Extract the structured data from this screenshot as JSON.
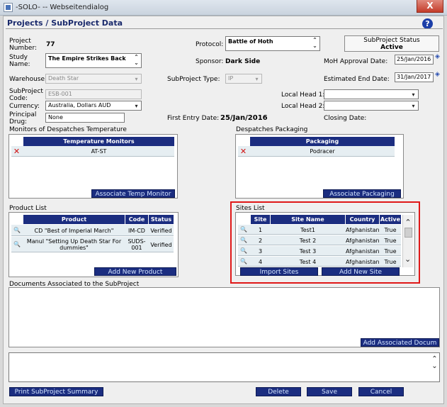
{
  "window": {
    "title": "-SOLO- -- Webseitendialog",
    "close_glyph": "X"
  },
  "header": {
    "title": "Projects / SubProject Data",
    "help_glyph": "?"
  },
  "form": {
    "project_number_label": "Project Number:",
    "project_number": "77",
    "study_name_label": "Study Name:",
    "study_name": "The Empire Strikes Back",
    "protocol_label": "Protocol:",
    "protocol": "Battle of Hoth",
    "sponsor_label": "Sponsor:",
    "sponsor": "Dark Side",
    "status_title": "SubProject Status",
    "status_value": "Active",
    "moh_label": "MoH Approval Date:",
    "moh_date": "25/Jan/2016",
    "warehouse_label": "Warehouse:",
    "warehouse": "Death Star",
    "subproject_type_label": "SubProject Type:",
    "subproject_type": "IP",
    "est_end_label": "Estimated End Date:",
    "est_end_date": "31/Jan/2017",
    "subproject_code_label": "SubProject Code:",
    "subproject_code": "ESB-001",
    "local_head1_label": "Local Head 1:",
    "local_head1": "",
    "currency_label": "Currency:",
    "currency": "Australia, Dollars AUD",
    "local_head2_label": "Local Head 2:",
    "local_head2": "",
    "principal_drug_label": "Principal Drug:",
    "principal_drug": "None",
    "first_entry_label": "First Entry Date:",
    "first_entry_date": "25/Jan/2016",
    "closing_label": "Closing Date:",
    "closing_date": ""
  },
  "monitors": {
    "title": "Monitors of Despatches Temperature",
    "column": "Temperature Monitors",
    "rows": [
      "AT-ST"
    ],
    "button": "Associate Temp Monitor"
  },
  "packaging": {
    "title": "Despatches Packaging",
    "column": "Packaging",
    "rows": [
      "Podracer"
    ],
    "button": "Associate Packaging"
  },
  "products": {
    "title": "Product List",
    "columns": [
      "Product",
      "Code",
      "Status"
    ],
    "rows": [
      {
        "product": "CD \"Best of Imperial March\"",
        "code": "IM-CD",
        "status": "Verified"
      },
      {
        "product_line1": "Manul \"Setting Up Death Star For",
        "product_line2": "dummies\"",
        "code_line1": "SUDS-",
        "code_line2": "001",
        "status": "Verified"
      }
    ],
    "button": "Add New Product"
  },
  "sites": {
    "title": "Sites List",
    "columns": [
      "Site",
      "Site Name",
      "Country",
      "Active"
    ],
    "rows": [
      {
        "site": "1",
        "name": "Test1",
        "country": "Afghanistan",
        "active": "True"
      },
      {
        "site": "2",
        "name": "Test 2",
        "country": "Afghanistan",
        "active": "True"
      },
      {
        "site": "3",
        "name": "Test 3",
        "country": "Afghanistan",
        "active": "True"
      },
      {
        "site": "4",
        "name": "Test 4",
        "country": "Afghanistan",
        "active": "True"
      }
    ],
    "import_button": "Import Sites",
    "add_button": "Add New Site"
  },
  "documents": {
    "title": "Documents Associated to the SubProject",
    "button": "Add Associated Docum"
  },
  "footer": {
    "print_button": "Print SubProject Summary",
    "delete_button": "Delete",
    "save_button": "Save",
    "cancel_button": "Cancel"
  },
  "icons": {
    "select_arrow": "▾",
    "scroll_up": "⌃",
    "scroll_down": "⌄",
    "delete": "✕",
    "view": "🔍"
  }
}
